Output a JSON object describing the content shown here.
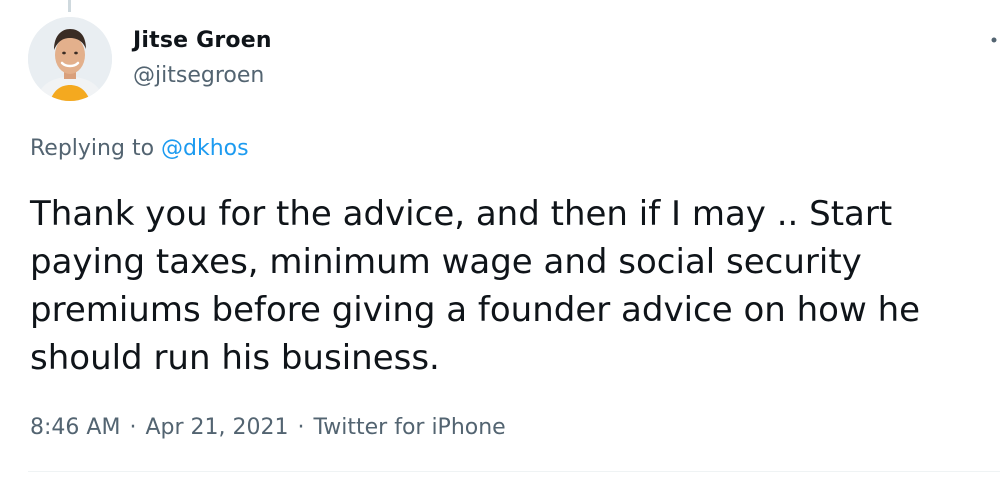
{
  "tweet": {
    "author": {
      "name": "Jitse Groen",
      "handle": "@jitsegroen",
      "avatar_icon": "profile-photo"
    },
    "replying_prefix": "Replying to",
    "replying_handle": "@dkhos",
    "text": "Thank you for the advice, and then if I may .. Start paying taxes, minimum wage and social security premiums before giving a founder advice on how he should run his business.",
    "time": "8:46 AM",
    "separator": "·",
    "date": "Apr 21, 2021",
    "source": "Twitter for iPhone"
  },
  "icons": {
    "more": "more-dots-icon"
  },
  "colors": {
    "text": "#0f1419",
    "secondary": "#536471",
    "link": "#1d9bf0",
    "divider": "#eff3f4"
  }
}
